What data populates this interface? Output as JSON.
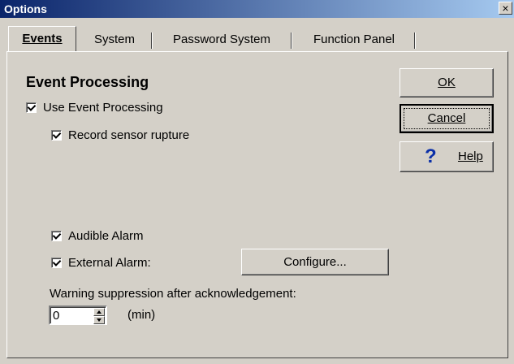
{
  "window": {
    "title": "Options",
    "close_glyph": "×"
  },
  "tabs": [
    {
      "label": "Events",
      "active": true
    },
    {
      "label": "System",
      "active": false
    },
    {
      "label": "Password System",
      "active": false
    },
    {
      "label": "Function Panel",
      "active": false
    }
  ],
  "events": {
    "heading": "Event Processing",
    "use_event_processing": {
      "label": "Use Event Processing",
      "checked": true
    },
    "record_sensor_rupture": {
      "label": "Record sensor rupture",
      "checked": true
    },
    "audible_alarm": {
      "label": "Audible Alarm",
      "checked": true
    },
    "external_alarm": {
      "label": "External Alarm:",
      "checked": true
    },
    "configure_button": "Configure...",
    "suppression_label": "Warning suppression after acknowledgement:",
    "suppression_value": "0",
    "suppression_unit": "(min)"
  },
  "buttons": {
    "ok": "OK",
    "cancel": "Cancel",
    "help": "Help",
    "help_icon": "question-mark-icon"
  }
}
